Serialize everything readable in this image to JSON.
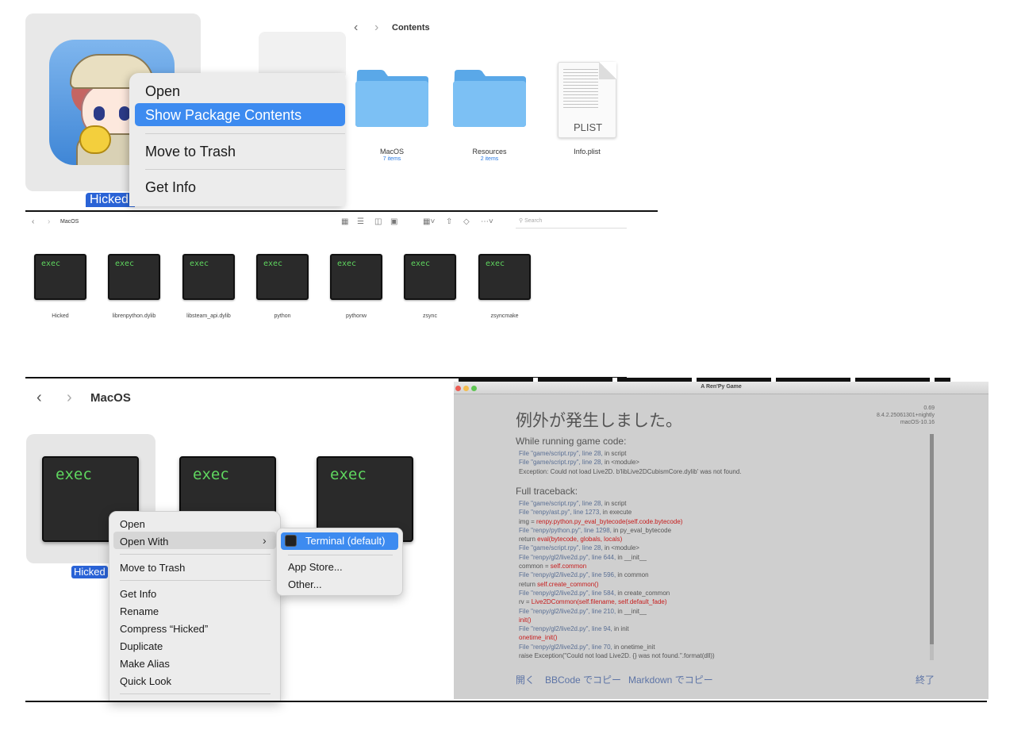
{
  "panel1": {
    "app_label": "Hicked",
    "context_menu": [
      "Open",
      "Show Package Contents",
      "Move to Trash",
      "Get Info"
    ],
    "finder": {
      "title": "Contents",
      "items": [
        {
          "name": "MacOS",
          "count": "7 items"
        },
        {
          "name": "Resources",
          "count": "2 items"
        }
      ],
      "plist": {
        "name": "Info.plist",
        "badge": "PLIST"
      }
    }
  },
  "panel2": {
    "title": "MacOS",
    "search_placeholder": "Search",
    "exec_label": "exec",
    "files": [
      "Hicked",
      "librenpython.dylib",
      "libsteam_api.dylib",
      "python",
      "pythonw",
      "zsync",
      "zsyncmake"
    ]
  },
  "panel3": {
    "title": "MacOS",
    "exec_label": "exec",
    "selected_label": "Hicked",
    "context_menu": {
      "open": "Open",
      "open_with": "Open With",
      "move_to_trash": "Move to Trash",
      "get_info": "Get Info",
      "rename": "Rename",
      "compress": "Compress “Hicked”",
      "duplicate": "Duplicate",
      "make_alias": "Make Alias",
      "quick_look": "Quick Look"
    },
    "submenu": {
      "terminal": "Terminal (default)",
      "app_store": "App Store...",
      "other": "Other..."
    }
  },
  "renpy": {
    "window_title": "A Ren'Py Game",
    "heading": "例外が発生しました。",
    "version": [
      "0.69",
      "8.4.2.25061301+nightly",
      "macOS-10.16"
    ],
    "running_header": "While running game code:",
    "running_lines": [
      [
        [
          "f",
          "File \"game/script.rpy\", line 28,"
        ],
        [
          "g",
          " in script"
        ]
      ],
      [
        [
          "f",
          "File \"game/script.rpy\", line 28,"
        ],
        [
          "g",
          " in <module>"
        ]
      ],
      [
        [
          "g",
          "Exception: Could not load Live2D. b'libLive2DCubismCore.dylib' was not found."
        ]
      ]
    ],
    "full_header": "Full traceback:",
    "full_lines": [
      [
        [
          "f",
          "File \"game/script.rpy\", line 28,"
        ],
        [
          "g",
          " in script"
        ]
      ],
      [
        [
          "f",
          "File \"renpy/ast.py\", line 1273,"
        ],
        [
          "g",
          " in execute"
        ]
      ],
      [
        [
          "g",
          "  img = "
        ],
        [
          "r",
          "renpy.python.py_eval_bytecode(self.code.bytecode)"
        ]
      ],
      [
        [
          "f",
          "File \"renpy/python.py\", line 1298,"
        ],
        [
          "g",
          " in py_eval_bytecode"
        ]
      ],
      [
        [
          "g",
          "  return "
        ],
        [
          "r",
          "eval(bytecode, globals, locals)"
        ]
      ],
      [
        [
          "f",
          "File \"game/script.rpy\", line 28,"
        ],
        [
          "g",
          " in <module>"
        ]
      ],
      [
        [
          "f",
          "File \"renpy/gl2/live2d.py\", line 644,"
        ],
        [
          "g",
          " in __init__"
        ]
      ],
      [
        [
          "g",
          "  common = "
        ],
        [
          "r",
          "self.common"
        ]
      ],
      [
        [
          "f",
          "File \"renpy/gl2/live2d.py\", line 596,"
        ],
        [
          "g",
          " in common"
        ]
      ],
      [
        [
          "g",
          "  return "
        ],
        [
          "r",
          "self.create_common()"
        ]
      ],
      [
        [
          "f",
          "File \"renpy/gl2/live2d.py\", line 584,"
        ],
        [
          "g",
          " in create_common"
        ]
      ],
      [
        [
          "g",
          "  rv = "
        ],
        [
          "r",
          "Live2DCommon(self.filename, self.default_fade)"
        ]
      ],
      [
        [
          "f",
          "File \"renpy/gl2/live2d.py\", line 210,"
        ],
        [
          "g",
          " in __init__"
        ]
      ],
      [
        [
          "r",
          "  init()"
        ]
      ],
      [
        [
          "f",
          "File \"renpy/gl2/live2d.py\", line 94,"
        ],
        [
          "g",
          " in init"
        ]
      ],
      [
        [
          "r",
          "  onetime_init()"
        ]
      ],
      [
        [
          "f",
          "File \"renpy/gl2/live2d.py\", line 70,"
        ],
        [
          "g",
          " in onetime_init"
        ]
      ],
      [
        [
          "g",
          "  raise Exception(\"Could not load Live2D. {} was not found.\".format(dll))"
        ]
      ]
    ],
    "footer": {
      "open": "開く",
      "bbcode": "BBCode でコピー",
      "markdown": "Markdown でコピー",
      "quit": "終了"
    }
  },
  "colors": {
    "accent": "#3d8bf0",
    "selection": "#2a63d6",
    "exec_text": "#5fd65f",
    "trace_file": "#5a6f94",
    "trace_error": "#c71c1c"
  }
}
